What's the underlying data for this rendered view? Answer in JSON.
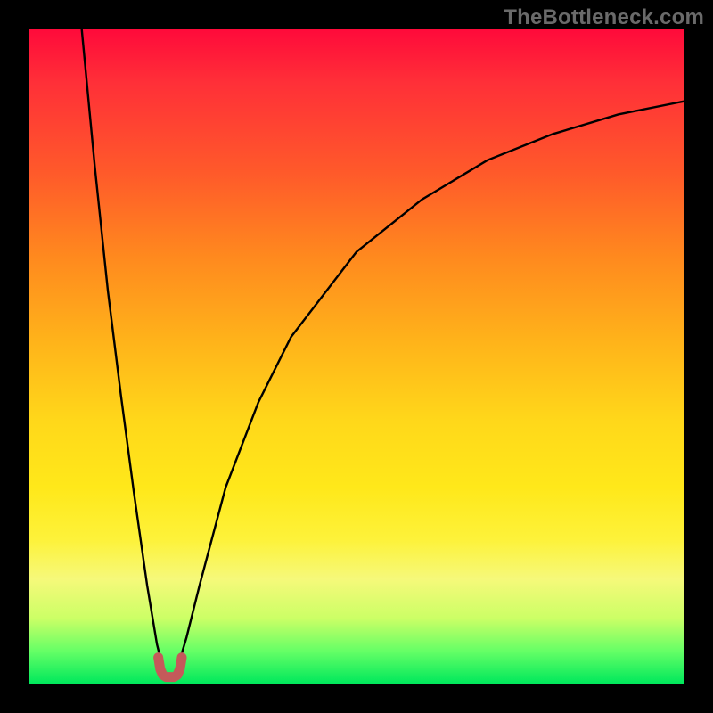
{
  "attribution": "TheBottleneck.com",
  "colors": {
    "gradient_top": "#ff0a3a",
    "gradient_bottom": "#00e85c",
    "curve": "#000000",
    "marker": "#c45a5a",
    "frame": "#000000"
  },
  "chart_data": {
    "type": "line",
    "title": "",
    "xlabel": "",
    "ylabel": "",
    "xlim": [
      0,
      100
    ],
    "ylim": [
      0,
      100
    ],
    "notch_x": 21,
    "series": [
      {
        "name": "left-branch",
        "x": [
          8,
          10,
          12,
          14,
          16,
          18,
          19.5,
          20.5
        ],
        "y": [
          100,
          79,
          60,
          44,
          29,
          15,
          6,
          2
        ]
      },
      {
        "name": "right-branch",
        "x": [
          22.5,
          24,
          26,
          30,
          35,
          40,
          50,
          60,
          70,
          80,
          90,
          100
        ],
        "y": [
          2,
          7,
          15,
          30,
          43,
          53,
          66,
          74,
          80,
          84,
          87,
          89
        ]
      },
      {
        "name": "notch-marker",
        "x": [
          19.7,
          20.0,
          20.4,
          20.9,
          21.5,
          22.1,
          22.6,
          23.0,
          23.3
        ],
        "y": [
          4.0,
          2.2,
          1.3,
          1.0,
          1.0,
          1.0,
          1.3,
          2.2,
          4.0
        ]
      }
    ]
  }
}
